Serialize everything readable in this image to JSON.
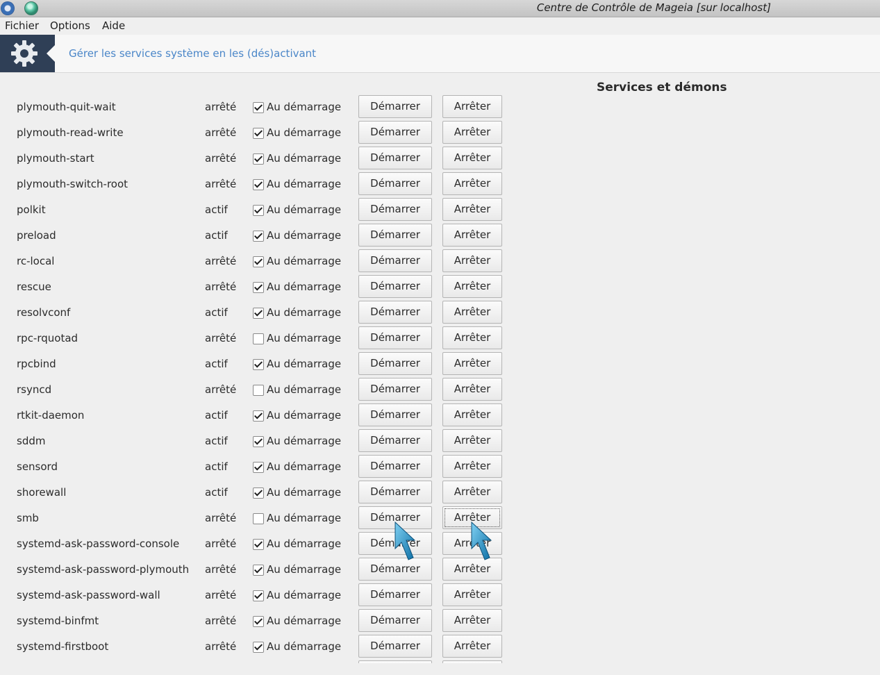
{
  "window": {
    "title": "Centre de Contrôle de Mageia [sur localhost]",
    "icons": [
      "mageia-gear-icon",
      "window-ball-icon"
    ]
  },
  "menu": [
    "Fichier",
    "Options",
    "Aide"
  ],
  "header": {
    "icon": "gear-icon",
    "title": "Gérer les services système en les (dés)activant"
  },
  "section_title": "Services et démons",
  "labels": {
    "on_boot": "Au démarrage",
    "start": "Démarrer",
    "stop": "Arrêter"
  },
  "services": [
    {
      "name": "plymouth-quit-wait",
      "state": "arrêté",
      "on_boot": true
    },
    {
      "name": "plymouth-read-write",
      "state": "arrêté",
      "on_boot": true
    },
    {
      "name": "plymouth-start",
      "state": "arrêté",
      "on_boot": true
    },
    {
      "name": "plymouth-switch-root",
      "state": "arrêté",
      "on_boot": true
    },
    {
      "name": "polkit",
      "state": "actif",
      "on_boot": true
    },
    {
      "name": "preload",
      "state": "actif",
      "on_boot": true
    },
    {
      "name": "rc-local",
      "state": "arrêté",
      "on_boot": true
    },
    {
      "name": "rescue",
      "state": "arrêté",
      "on_boot": true
    },
    {
      "name": "resolvconf",
      "state": "actif",
      "on_boot": true
    },
    {
      "name": "rpc-rquotad",
      "state": "arrêté",
      "on_boot": false
    },
    {
      "name": "rpcbind",
      "state": "actif",
      "on_boot": true
    },
    {
      "name": "rsyncd",
      "state": "arrêté",
      "on_boot": false
    },
    {
      "name": "rtkit-daemon",
      "state": "actif",
      "on_boot": true
    },
    {
      "name": "sddm",
      "state": "actif",
      "on_boot": true
    },
    {
      "name": "sensord",
      "state": "actif",
      "on_boot": true
    },
    {
      "name": "shorewall",
      "state": "actif",
      "on_boot": true
    },
    {
      "name": "smb",
      "state": "arrêté",
      "on_boot": false,
      "focused": "stop"
    },
    {
      "name": "systemd-ask-password-console",
      "state": "arrêté",
      "on_boot": true
    },
    {
      "name": "systemd-ask-password-plymouth",
      "state": "arrêté",
      "on_boot": true
    },
    {
      "name": "systemd-ask-password-wall",
      "state": "arrêté",
      "on_boot": true
    },
    {
      "name": "systemd-binfmt",
      "state": "arrêté",
      "on_boot": true
    },
    {
      "name": "systemd-firstboot",
      "state": "arrêté",
      "on_boot": true
    }
  ],
  "overlay_cursors": [
    "pointer-cursor-icon",
    "pointer-cursor-icon"
  ]
}
